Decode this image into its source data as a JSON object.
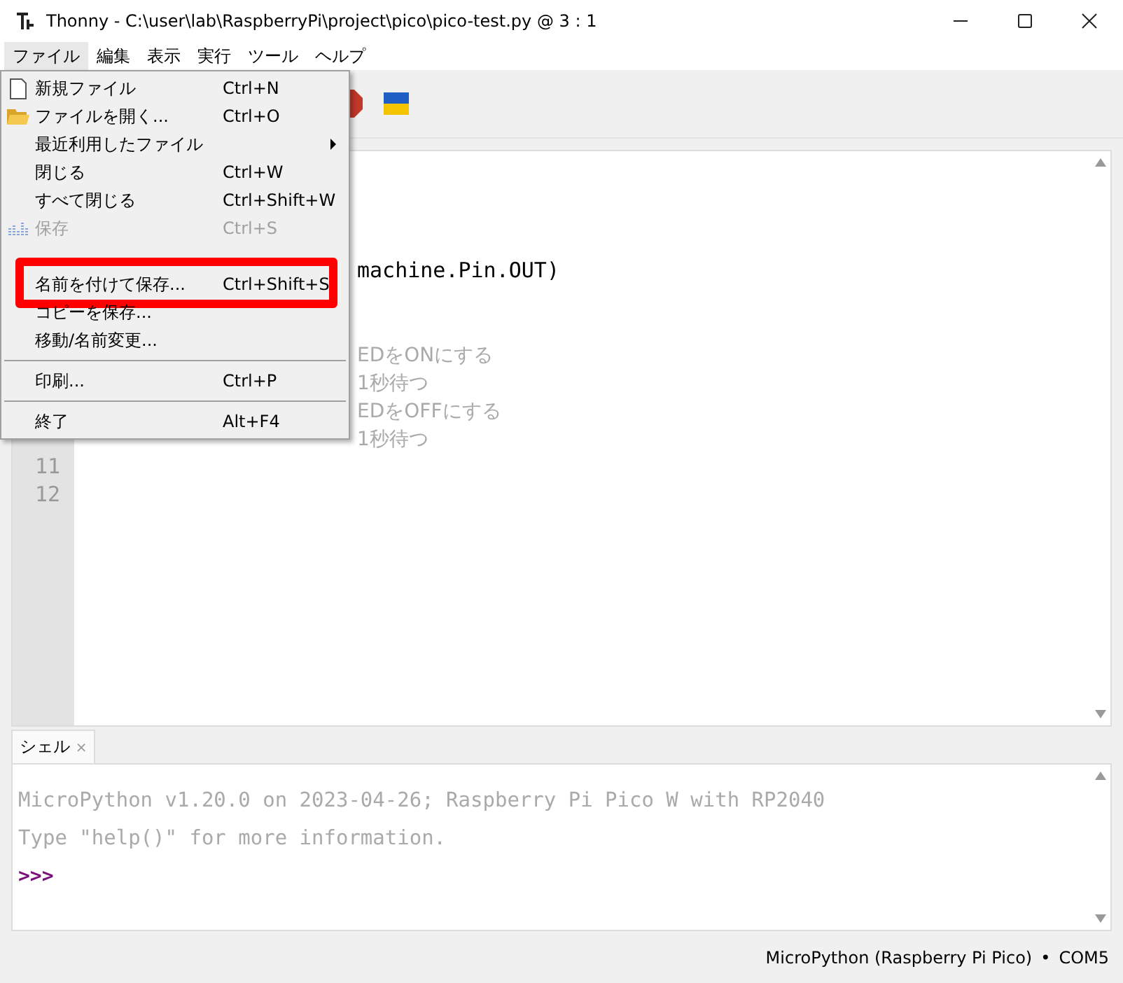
{
  "window": {
    "title": "Thonny  -  C:\\user\\lab\\RaspberryPi\\project\\pico\\pico-test.py  @  3 : 1"
  },
  "menubar": [
    {
      "label": "ファイル",
      "selected": true
    },
    {
      "label": "編集",
      "selected": false
    },
    {
      "label": "表示",
      "selected": false
    },
    {
      "label": "実行",
      "selected": false
    },
    {
      "label": "ツール",
      "selected": false
    },
    {
      "label": "ヘルプ",
      "selected": false
    }
  ],
  "file_menu": [
    {
      "kind": "item",
      "label": "新規ファイル",
      "shortcut": "Ctrl+N",
      "disabled": false,
      "highlighted": false
    },
    {
      "kind": "item",
      "label": "ファイルを開く...",
      "shortcut": "Ctrl+O",
      "disabled": false,
      "highlighted": false
    },
    {
      "kind": "submenu",
      "label": "最近利用したファイル",
      "disabled": false,
      "highlighted": false
    },
    {
      "kind": "item",
      "label": "閉じる",
      "shortcut": "Ctrl+W",
      "disabled": false,
      "highlighted": false
    },
    {
      "kind": "item",
      "label": "すべて閉じる",
      "shortcut": "Ctrl+Shift+W",
      "disabled": false,
      "highlighted": false
    },
    {
      "kind": "item",
      "label": "保存",
      "shortcut": "Ctrl+S",
      "disabled": true,
      "highlighted": false
    },
    {
      "kind": "item",
      "label": "名前を付けて保存...",
      "shortcut": "Ctrl+Shift+S",
      "disabled": false,
      "highlighted": true
    },
    {
      "kind": "item",
      "label": "コピーを保存...",
      "disabled": false,
      "highlighted": false
    },
    {
      "kind": "item",
      "label": "移動/名前変更...",
      "disabled": false,
      "highlighted": false
    },
    {
      "kind": "separator"
    },
    {
      "kind": "item",
      "label": "印刷...",
      "shortcut": "Ctrl+P",
      "disabled": false,
      "highlighted": false
    },
    {
      "kind": "separator"
    },
    {
      "kind": "item",
      "label": "終了",
      "shortcut": "Alt+F4",
      "disabled": false,
      "highlighted": false
    }
  ],
  "editor": {
    "code": [
      {
        "kind": "code",
        "text": "machine.Pin.OUT)"
      },
      {
        "kind": "comment",
        "text": "EDをONにする"
      },
      {
        "kind": "comment",
        "text": "1秒待つ"
      },
      {
        "kind": "comment",
        "text": "EDをOFFにする"
      },
      {
        "kind": "comment",
        "text": "1秒待つ"
      }
    ],
    "line_numbers": [
      "11",
      "12"
    ]
  },
  "shell": {
    "tab": "シェル",
    "close": "×",
    "lines": [
      {
        "kind": "output",
        "text": "MicroPython v1.20.0 on 2023-04-26; Raspberry Pi Pico W with RP2040"
      },
      {
        "kind": "output",
        "text": "Type \"help()\" for more information."
      },
      {
        "kind": "prompt",
        "text": ">>>"
      }
    ]
  },
  "status_bar": {
    "interpreter": "MicroPython (Raspberry Pi Pico)",
    "separator": "•",
    "port": "COM5"
  }
}
